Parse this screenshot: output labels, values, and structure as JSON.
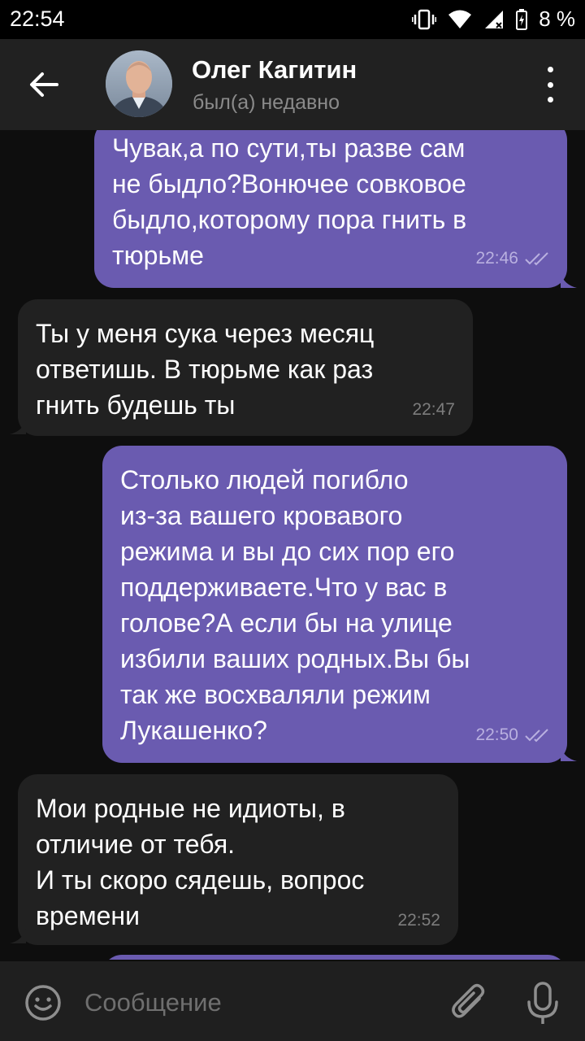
{
  "status_bar": {
    "time": "22:54",
    "battery": "8 %",
    "icons": [
      "vibrate-icon",
      "wifi-icon",
      "signal-icon",
      "battery-icon"
    ]
  },
  "header": {
    "contact_name": "Олег Кагитин",
    "contact_status": "был(а) недавно",
    "icons": [
      "back-arrow-icon",
      "more-vert-icon"
    ]
  },
  "messages": [
    {
      "direction": "outgoing",
      "text": "Чувак,а по сути,ты разве сам\nне быдло?Вонючее совковое\nбыдло,которому пора гнить в\nтюрьме",
      "time": "22:46",
      "read": true
    },
    {
      "direction": "incoming",
      "text": "Ты у меня сука через месяц\nответишь. В тюрьме как раз\nгнить будешь ты",
      "time": "22:47"
    },
    {
      "direction": "outgoing",
      "text": "Столько людей погибло\nиз-за вашего кровавого\nрежима и вы до сих пор его\nподдерживаете.Что у вас в\nголове?А если бы на улице\nизбили ваших родных.Вы бы\nтак же восхваляли режим\nЛукашенко?",
      "time": "22:50",
      "read": true
    },
    {
      "direction": "incoming",
      "text": "Мои родные не идиоты, в\nотличие от тебя.\nИ ты скоро сядешь, вопрос\nвремени",
      "time": "22:52"
    }
  ],
  "input_bar": {
    "placeholder": "Сообщение",
    "icons": [
      "emoji-icon",
      "attach-icon",
      "microphone-icon"
    ]
  },
  "colors": {
    "outgoing_bubble": "#6a5bb0",
    "incoming_bubble": "#212121",
    "header": "#212121",
    "background": "#0e0e0e"
  }
}
